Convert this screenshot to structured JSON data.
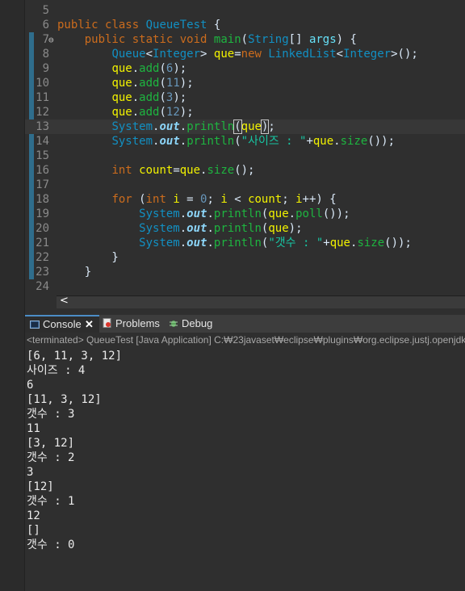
{
  "editor": {
    "lines": [
      {
        "n": "5",
        "segs": []
      },
      {
        "n": "6",
        "segs": [
          [
            "kw",
            "public "
          ],
          [
            "kw",
            "class "
          ],
          [
            "ty",
            "QueueTest"
          ],
          [
            "",
            " {"
          ]
        ]
      },
      {
        "n": "7",
        "fold": "⊖",
        "segs": [
          [
            "",
            "    "
          ],
          [
            "kw",
            "public "
          ],
          [
            "kw",
            "static "
          ],
          [
            "kw",
            "void "
          ],
          [
            "mt",
            "main"
          ],
          [
            "",
            "("
          ],
          [
            "ty",
            "String"
          ],
          [
            "",
            "[] "
          ],
          [
            "pl",
            "args"
          ],
          [
            "",
            ") {"
          ]
        ]
      },
      {
        "n": "8",
        "segs": [
          [
            "",
            "        "
          ],
          [
            "ty",
            "Queue"
          ],
          [
            "",
            "<"
          ],
          [
            "ty",
            "Integer"
          ],
          [
            "",
            "> "
          ],
          [
            "vr",
            "que"
          ],
          [
            "",
            "="
          ],
          [
            "kw",
            "new "
          ],
          [
            "ty",
            "LinkedList"
          ],
          [
            "",
            "<"
          ],
          [
            "ty",
            "Integer"
          ],
          [
            "",
            ">();"
          ]
        ]
      },
      {
        "n": "9",
        "segs": [
          [
            "",
            "        "
          ],
          [
            "vr",
            "que"
          ],
          [
            "",
            "."
          ],
          [
            "mt",
            "add"
          ],
          [
            "",
            "("
          ],
          [
            "nm",
            "6"
          ],
          [
            "",
            ");"
          ]
        ]
      },
      {
        "n": "10",
        "segs": [
          [
            "",
            "        "
          ],
          [
            "vr",
            "que"
          ],
          [
            "",
            "."
          ],
          [
            "mt",
            "add"
          ],
          [
            "",
            "("
          ],
          [
            "nm",
            "11"
          ],
          [
            "",
            ");"
          ]
        ]
      },
      {
        "n": "11",
        "segs": [
          [
            "",
            "        "
          ],
          [
            "vr",
            "que"
          ],
          [
            "",
            "."
          ],
          [
            "mt",
            "add"
          ],
          [
            "",
            "("
          ],
          [
            "nm",
            "3"
          ],
          [
            "",
            ");"
          ]
        ]
      },
      {
        "n": "12",
        "segs": [
          [
            "",
            "        "
          ],
          [
            "vr",
            "que"
          ],
          [
            "",
            "."
          ],
          [
            "mt",
            "add"
          ],
          [
            "",
            "("
          ],
          [
            "nm",
            "12"
          ],
          [
            "",
            ");"
          ]
        ]
      },
      {
        "n": "13",
        "current": true,
        "segs": [
          [
            "",
            "        "
          ],
          [
            "ty",
            "System"
          ],
          [
            "",
            "."
          ],
          [
            "fl",
            "out"
          ],
          [
            "",
            "."
          ],
          [
            "mt",
            "println"
          ],
          [
            "bracket",
            "("
          ],
          [
            "vr",
            "que"
          ],
          [
            "bracket",
            ")"
          ],
          [
            "",
            ";"
          ]
        ]
      },
      {
        "n": "14",
        "segs": [
          [
            "",
            "        "
          ],
          [
            "ty",
            "System"
          ],
          [
            "",
            "."
          ],
          [
            "fl",
            "out"
          ],
          [
            "",
            "."
          ],
          [
            "mt",
            "println"
          ],
          [
            "",
            "("
          ],
          [
            "st",
            "\"사이즈 : \""
          ],
          [
            "",
            "+"
          ],
          [
            "vr",
            "que"
          ],
          [
            "",
            "."
          ],
          [
            "mt",
            "size"
          ],
          [
            "",
            "());"
          ]
        ]
      },
      {
        "n": "15",
        "segs": []
      },
      {
        "n": "16",
        "segs": [
          [
            "",
            "        "
          ],
          [
            "kw",
            "int "
          ],
          [
            "vr",
            "count"
          ],
          [
            "",
            "="
          ],
          [
            "vr",
            "que"
          ],
          [
            "",
            "."
          ],
          [
            "mt",
            "size"
          ],
          [
            "",
            "();"
          ]
        ]
      },
      {
        "n": "17",
        "segs": []
      },
      {
        "n": "18",
        "segs": [
          [
            "",
            "        "
          ],
          [
            "kw",
            "for "
          ],
          [
            "",
            "("
          ],
          [
            "kw",
            "int "
          ],
          [
            "vr",
            "i"
          ],
          [
            "",
            " = "
          ],
          [
            "nm",
            "0"
          ],
          [
            "",
            "; "
          ],
          [
            "vr",
            "i"
          ],
          [
            "",
            " < "
          ],
          [
            "vr",
            "count"
          ],
          [
            "",
            "; "
          ],
          [
            "vr",
            "i"
          ],
          [
            "",
            "++) {"
          ]
        ]
      },
      {
        "n": "19",
        "segs": [
          [
            "",
            "            "
          ],
          [
            "ty",
            "System"
          ],
          [
            "",
            "."
          ],
          [
            "fl",
            "out"
          ],
          [
            "",
            "."
          ],
          [
            "mt",
            "println"
          ],
          [
            "",
            "("
          ],
          [
            "vr",
            "que"
          ],
          [
            "",
            "."
          ],
          [
            "mt",
            "poll"
          ],
          [
            "",
            "());"
          ]
        ]
      },
      {
        "n": "20",
        "segs": [
          [
            "",
            "            "
          ],
          [
            "ty",
            "System"
          ],
          [
            "",
            "."
          ],
          [
            "fl",
            "out"
          ],
          [
            "",
            "."
          ],
          [
            "mt",
            "println"
          ],
          [
            "",
            "("
          ],
          [
            "vr",
            "que"
          ],
          [
            "",
            ");"
          ]
        ]
      },
      {
        "n": "21",
        "segs": [
          [
            "",
            "            "
          ],
          [
            "ty",
            "System"
          ],
          [
            "",
            "."
          ],
          [
            "fl",
            "out"
          ],
          [
            "",
            "."
          ],
          [
            "mt",
            "println"
          ],
          [
            "",
            "("
          ],
          [
            "st",
            "\"갯수 : \""
          ],
          [
            "",
            "+"
          ],
          [
            "vr",
            "que"
          ],
          [
            "",
            "."
          ],
          [
            "mt",
            "size"
          ],
          [
            "",
            "());"
          ]
        ]
      },
      {
        "n": "22",
        "segs": [
          [
            "",
            "        }"
          ]
        ]
      },
      {
        "n": "23",
        "segs": [
          [
            "",
            "    }"
          ]
        ]
      },
      {
        "n": "24",
        "segs": []
      }
    ]
  },
  "scrollbar": {
    "left_arrow": "<"
  },
  "tabs": {
    "console": {
      "label": "Console",
      "close": "✕"
    },
    "problems": {
      "label": "Problems"
    },
    "debug": {
      "label": "Debug"
    }
  },
  "console": {
    "header": "<terminated> QueueTest [Java Application] C:₩23javaset₩eclipse₩plugins₩org.eclipse.justj.openjdk.h",
    "output": [
      "[6, 11, 3, 12]",
      "사이즈 : 4",
      "6",
      "[11, 3, 12]",
      "갯수 : 3",
      "11",
      "[3, 12]",
      "갯수 : 2",
      "3",
      "[12]",
      "갯수 : 1",
      "12",
      "[]",
      "갯수 : 0"
    ]
  },
  "colors": {
    "accent": "#4c8dc6",
    "keyword": "#cc6c1d",
    "type": "#1290c3",
    "method": "#1eb540",
    "string": "#17c6a3",
    "number": "#6897bb",
    "variable": "#f2f200"
  }
}
